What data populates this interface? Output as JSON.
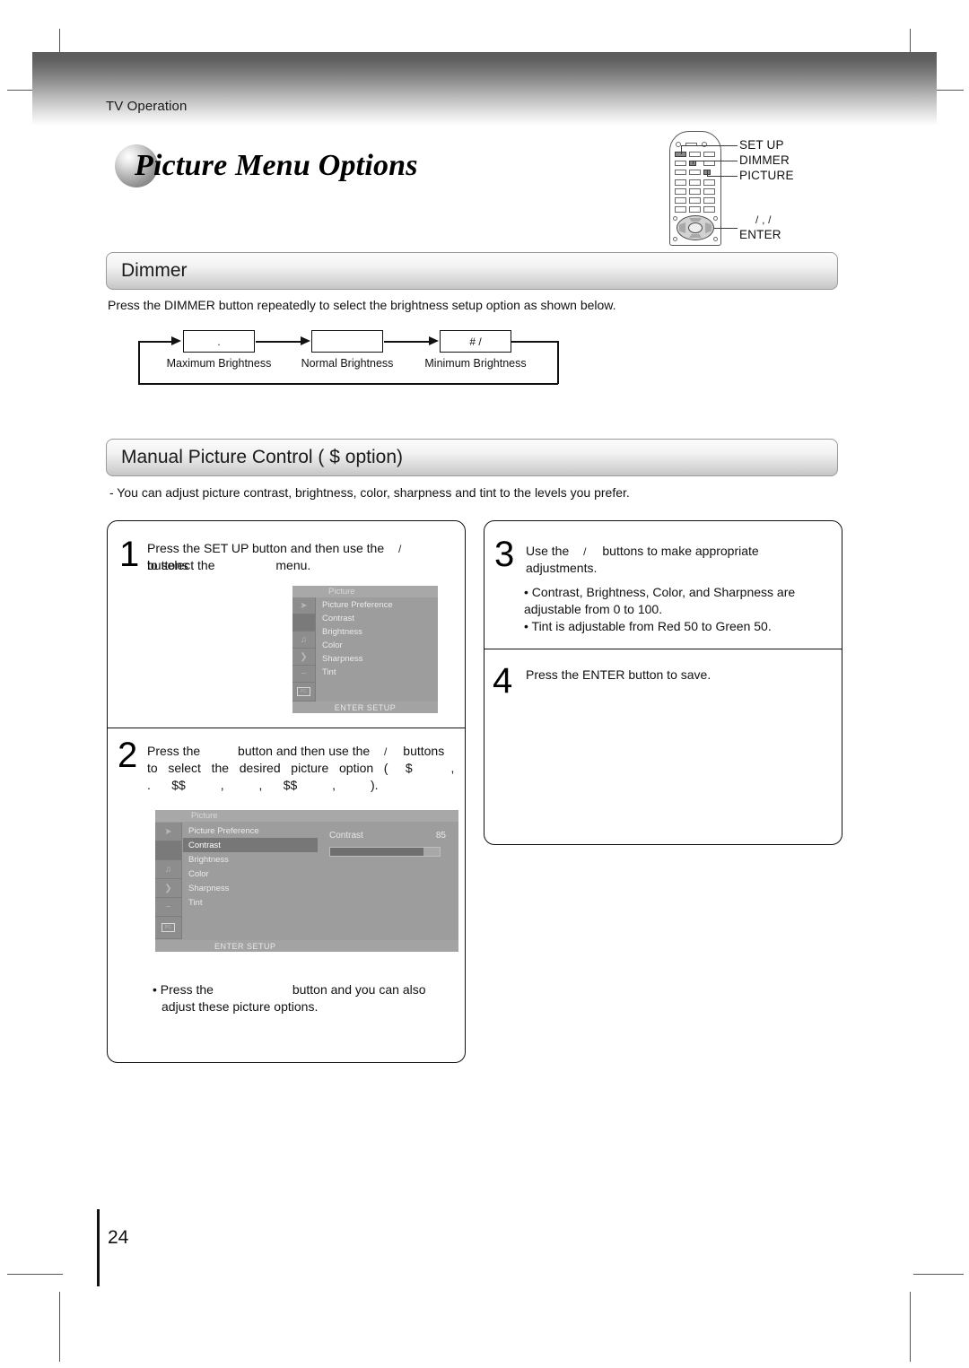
{
  "header": {
    "running_head": "TV Operation"
  },
  "page_title": "Picture Menu Options",
  "remote": {
    "labels": [
      {
        "id": "setup",
        "text": "SET UP"
      },
      {
        "id": "dimmer",
        "text": "DIMMER"
      },
      {
        "id": "picture",
        "text": "PICTURE"
      },
      {
        "id": "enter",
        "text": "ENTER"
      }
    ],
    "nav_glyphs": "/    ,     /"
  },
  "sections": [
    {
      "id": "dimmer",
      "heading": "Dimmer",
      "intro": "Press the DIMMER button repeatedly to select the brightness setup option as shown below.",
      "flow": {
        "steps": [
          {
            "box_glyph": ".",
            "caption": "Maximum Brightness"
          },
          {
            "box_glyph": "",
            "caption": "Normal Brightness"
          },
          {
            "box_glyph": "# /",
            "caption": "Minimum Brightness"
          }
        ]
      }
    },
    {
      "id": "manual-picture-control",
      "heading": "Manual Picture Control (    $        option)",
      "intro": "-   You can adjust picture contrast, brightness, color, sharpness and tint to the levels you prefer."
    }
  ],
  "steps": [
    {
      "number": "1",
      "line1": "Press the SET UP button and then use the",
      "glyph1": "/",
      "line1b": "buttons",
      "line2a": "to select the",
      "line2b": "menu."
    },
    {
      "number": "2",
      "line1": "Press the",
      "line1b": "button and then use the",
      "glyph1": "/",
      "line1c": "buttons",
      "line2": "to   select   the   desired   picture   option   (     $           ,",
      "line3": ".      $$          ,          ,      $$          ,          )."
    },
    {
      "number": "3",
      "line1a": "Use the",
      "glyph1": "/",
      "line1b": "buttons to make appropriate",
      "line2": "adjustments.",
      "bullets": [
        "• Contrast, Brightness, Color, and Sharpness are",
        "   adjustable from 0 to 100.",
        "• Tint is adjustable from Red 50 to Green 50."
      ]
    },
    {
      "number": "4",
      "line1": "Press the ENTER button to save."
    }
  ],
  "step2_note": {
    "line1a": "• Press the",
    "line1b": "button and you can also",
    "line2": "adjust these picture options."
  },
  "osd_menu_1": {
    "title": "Picture",
    "items": [
      "Picture Preference",
      "Contrast",
      "Brightness",
      "Color",
      "Sharpness",
      "Tint"
    ],
    "highlight_index": -1,
    "footer": "ENTER   SETUP",
    "icons": [
      "arrow-cursor-icon",
      "picture-icon",
      "audio-icon",
      "curve-icon",
      "swoosh-icon",
      "pc-icon"
    ],
    "selected_icon_index": 1,
    "pc_icon_label": "PC"
  },
  "osd_menu_2": {
    "title": "Picture",
    "items": [
      "Picture Preference",
      "Contrast",
      "Brightness",
      "Color",
      "Sharpness",
      "Tint"
    ],
    "highlight_index": 1,
    "footer": "ENTER   SETUP",
    "icons": [
      "arrow-cursor-icon",
      "picture-icon",
      "audio-icon",
      "curve-icon",
      "swoosh-icon",
      "pc-icon"
    ],
    "selected_icon_index": 1,
    "pc_icon_label": "PC",
    "detail": {
      "label": "Contrast",
      "value": "85",
      "percent": 85
    }
  },
  "page_number": "24",
  "colors": {
    "osd_bg": "#9d9d9d",
    "osd_highlight": "#777777",
    "osd_bar_fill": "#6f6f6f",
    "heading_bar_top": "#fbfbfb",
    "heading_bar_bottom": "#c6c6c6",
    "header_band_dark": "#5d5d5d"
  }
}
